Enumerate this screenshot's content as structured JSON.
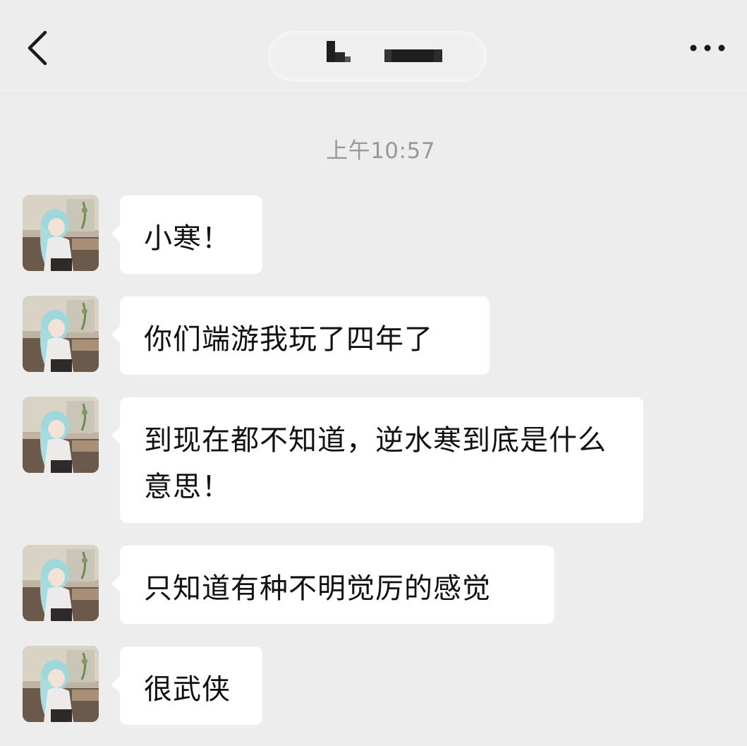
{
  "header": {
    "back_icon": "chevron-left-icon",
    "more_icon": "more-dots-icon",
    "title_redacted": true
  },
  "chat": {
    "timestamp": "上午10:57",
    "messages": [
      {
        "text": "小寒！"
      },
      {
        "text": "你们端游我玩了四年了"
      },
      {
        "text": "到现在都不知道，逆水寒到底是什么意思！"
      },
      {
        "text": "只知道有种不明觉厉的感觉"
      },
      {
        "text": "很武侠"
      }
    ]
  },
  "colors": {
    "background": "#ededed",
    "bubble": "#ffffff",
    "timestamp_text": "#999999",
    "message_text": "#111111"
  }
}
